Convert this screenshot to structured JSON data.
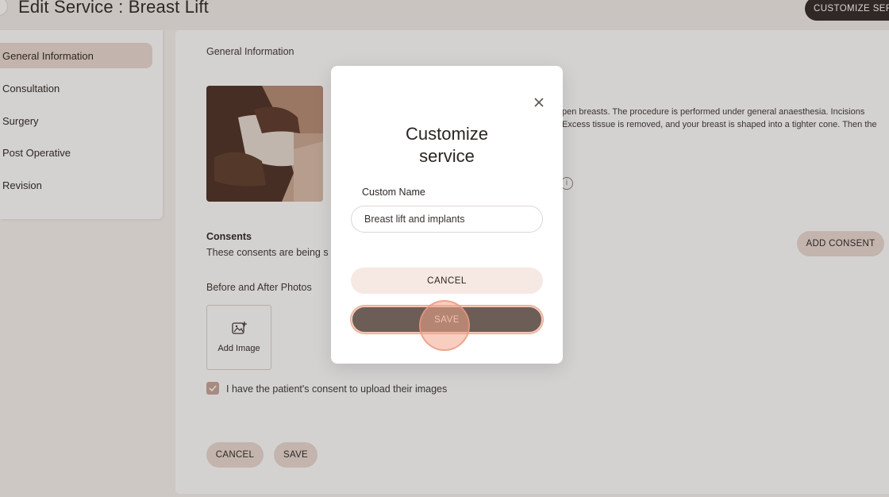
{
  "page": {
    "title": "Edit Service : Breast Lift",
    "customize_button": "CUSTOMIZE SERVICE"
  },
  "sidebar": {
    "items": [
      {
        "label": "General Information",
        "active": true
      },
      {
        "label": "Consultation"
      },
      {
        "label": "Surgery"
      },
      {
        "label": "Post Operative"
      },
      {
        "label": "Revision"
      }
    ]
  },
  "main": {
    "general_info_title": "General Information",
    "description_line1": "pen breasts. The procedure is performed under general anaesthesia. Incisions",
    "description_line2": "Excess tissue is removed, and your breast is shaped into a tighter cone. Then the",
    "consents_title": "Consents",
    "consents_subtitle": "These consents are being s",
    "add_consent_label": "ADD CONSENT",
    "photos_title": "Before and After Photos",
    "add_image_label": "Add Image",
    "consent_checkbox_label": "I have the patient's consent to upload their images",
    "cancel_label": "CANCEL",
    "save_label": "SAVE"
  },
  "modal": {
    "title": "Customize service",
    "field_label": "Custom Name",
    "field_value": "Breast lift and implants",
    "cancel_label": "CANCEL",
    "save_label": "SAVE"
  },
  "colors": {
    "accent": "#ead9d2",
    "dark_button": "#2d2623",
    "save_button": "#6c5e56",
    "checkbox": "#c7a597"
  },
  "icons": [
    "close-icon",
    "add-image-icon",
    "info-icon",
    "check-icon"
  ]
}
